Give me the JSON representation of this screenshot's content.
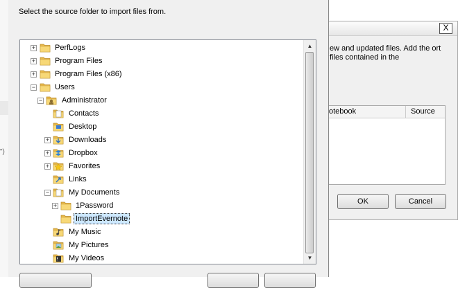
{
  "prompt": "Select the source folder to import files from.",
  "tree": [
    {
      "label": "PerfLogs",
      "expander": "+",
      "icon": "folder-icon"
    },
    {
      "label": "Program Files",
      "expander": "+",
      "icon": "folder-icon"
    },
    {
      "label": "Program Files (x86)",
      "expander": "+",
      "icon": "folder-icon"
    },
    {
      "label": "Users",
      "expander": "-",
      "icon": "folder-icon"
    },
    {
      "label": "Administrator",
      "expander": "-",
      "icon": "user-folder-icon"
    },
    {
      "label": "Contacts",
      "expander": "",
      "icon": "contacts-folder-icon"
    },
    {
      "label": "Desktop",
      "expander": "",
      "icon": "desktop-folder-icon"
    },
    {
      "label": "Downloads",
      "expander": "+",
      "icon": "downloads-folder-icon"
    },
    {
      "label": "Dropbox",
      "expander": "+",
      "icon": "dropbox-folder-icon"
    },
    {
      "label": "Favorites",
      "expander": "+",
      "icon": "favorites-folder-icon"
    },
    {
      "label": "Links",
      "expander": "",
      "icon": "links-folder-icon"
    },
    {
      "label": "My Documents",
      "expander": "-",
      "icon": "documents-folder-icon"
    },
    {
      "label": "1Password",
      "expander": "+",
      "icon": "folder-icon"
    },
    {
      "label": "ImportEvernote",
      "expander": "",
      "icon": "folder-icon",
      "selected": true
    },
    {
      "label": "My Music",
      "expander": "",
      "icon": "music-folder-icon"
    },
    {
      "label": "My Pictures",
      "expander": "",
      "icon": "pictures-folder-icon"
    },
    {
      "label": "My Videos",
      "expander": "",
      "icon": "videos-folder-icon"
    }
  ],
  "background_dialog": {
    "close_glyph": "X",
    "description": "ew and updated files. Add the ort files contained in the",
    "table": {
      "col1": "otebook",
      "col2": "Source"
    },
    "ok_label": "OK",
    "cancel_label": "Cancel"
  },
  "left_strip_glyph": "\")"
}
